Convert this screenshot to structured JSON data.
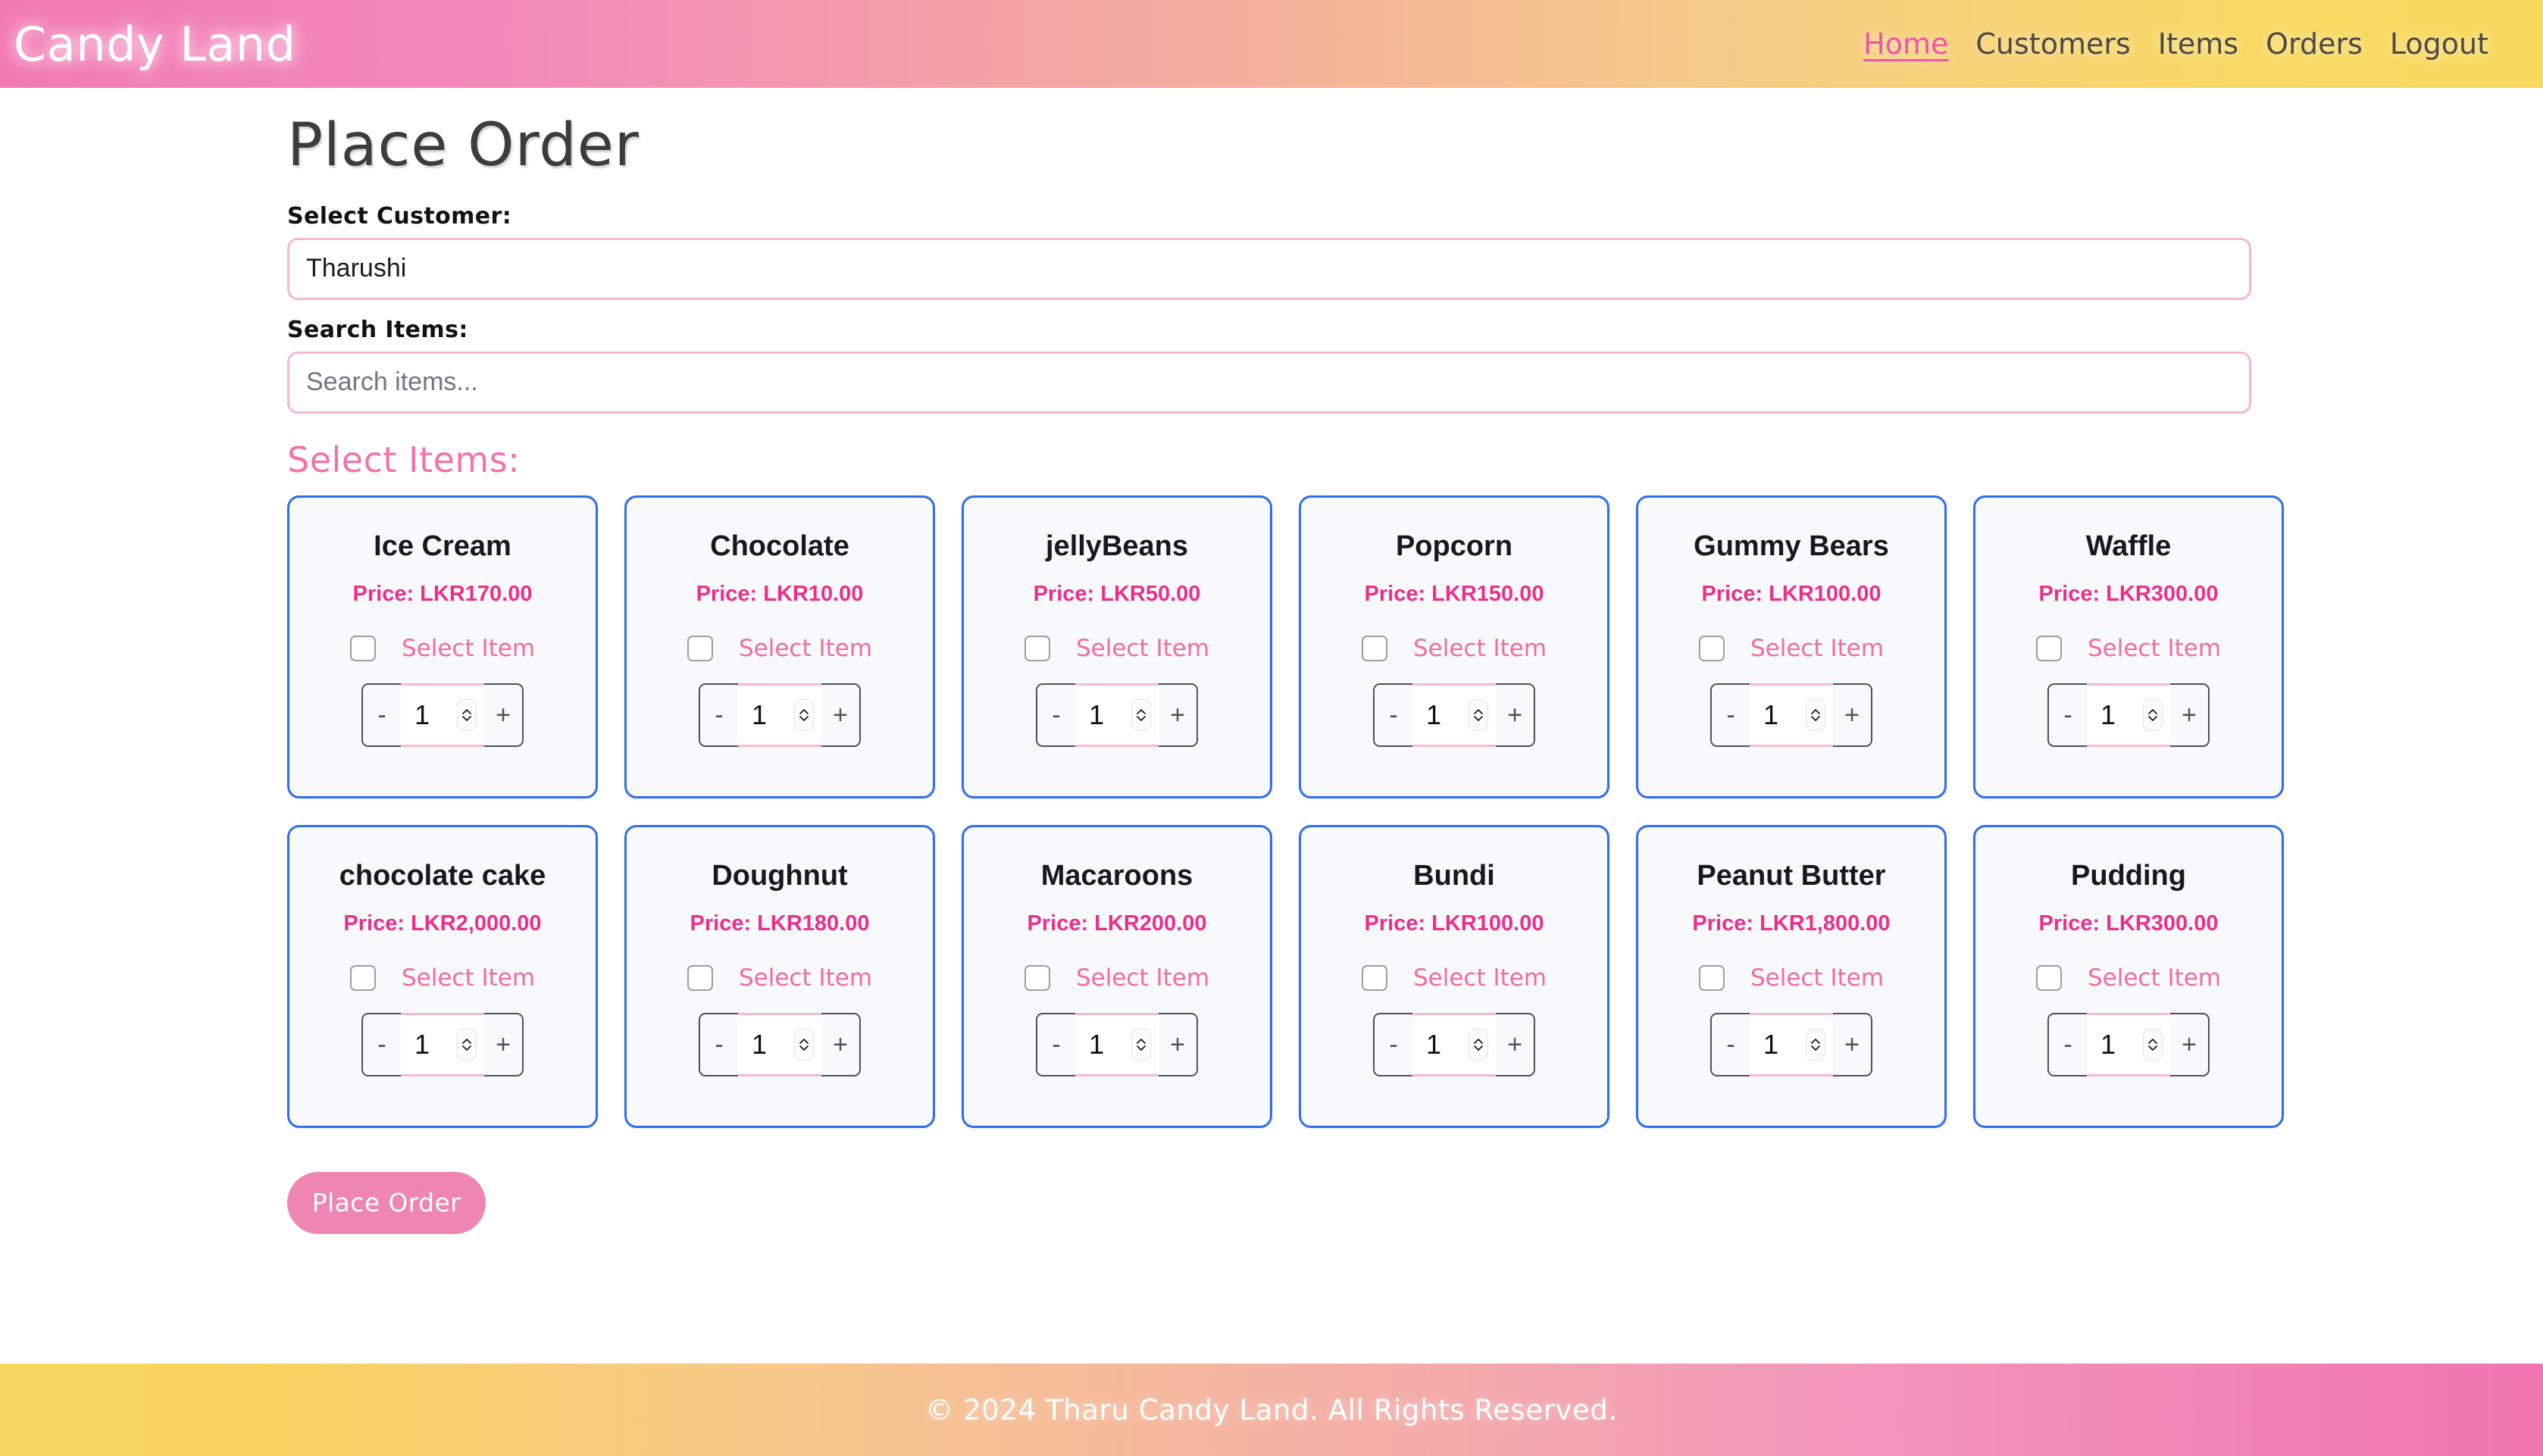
{
  "header": {
    "brand": "Candy Land",
    "nav": [
      {
        "label": "Home",
        "active": true
      },
      {
        "label": "Customers",
        "active": false
      },
      {
        "label": "Items",
        "active": false
      },
      {
        "label": "Orders",
        "active": false
      },
      {
        "label": "Logout",
        "active": false
      }
    ]
  },
  "page": {
    "title": "Place Order"
  },
  "customer": {
    "label": "Select Customer:",
    "value": "Tharushi"
  },
  "search": {
    "label": "Search Items:",
    "placeholder": "Search items...",
    "value": ""
  },
  "items_section": {
    "heading": "Select Items:",
    "select_item_label": "Select Item",
    "decrement_label": "-",
    "increment_label": "+",
    "default_quantity": "1"
  },
  "items": [
    {
      "name": "Ice Cream",
      "price": "Price: LKR170.00",
      "quantity": "1",
      "selected": false
    },
    {
      "name": "Chocolate",
      "price": "Price: LKR10.00",
      "quantity": "1",
      "selected": false
    },
    {
      "name": "jellyBeans",
      "price": "Price: LKR50.00",
      "quantity": "1",
      "selected": false
    },
    {
      "name": "Popcorn",
      "price": "Price: LKR150.00",
      "quantity": "1",
      "selected": false
    },
    {
      "name": "Gummy Bears",
      "price": "Price: LKR100.00",
      "quantity": "1",
      "selected": false
    },
    {
      "name": "Waffle",
      "price": "Price: LKR300.00",
      "quantity": "1",
      "selected": false
    },
    {
      "name": "chocolate cake",
      "price": "Price: LKR2,000.00",
      "quantity": "1",
      "selected": false
    },
    {
      "name": "Doughnut",
      "price": "Price: LKR180.00",
      "quantity": "1",
      "selected": false
    },
    {
      "name": "Macaroons",
      "price": "Price: LKR200.00",
      "quantity": "1",
      "selected": false
    },
    {
      "name": "Bundi",
      "price": "Price: LKR100.00",
      "quantity": "1",
      "selected": false
    },
    {
      "name": "Peanut Butter",
      "price": "Price: LKR1,800.00",
      "quantity": "1",
      "selected": false
    },
    {
      "name": "Pudding",
      "price": "Price: LKR300.00",
      "quantity": "1",
      "selected": false
    }
  ],
  "actions": {
    "place_order": "Place Order"
  },
  "footer": {
    "text": "© 2024 Tharu Candy Land. All Rights Reserved."
  },
  "colors": {
    "brand_pink": "#f279b4",
    "brand_yellow": "#f8d95e",
    "accent_pink": "#ed2e8c",
    "soft_pink": "#f273ab",
    "card_border_blue": "#2f6fe8",
    "button_pink": "#ef85b2"
  }
}
